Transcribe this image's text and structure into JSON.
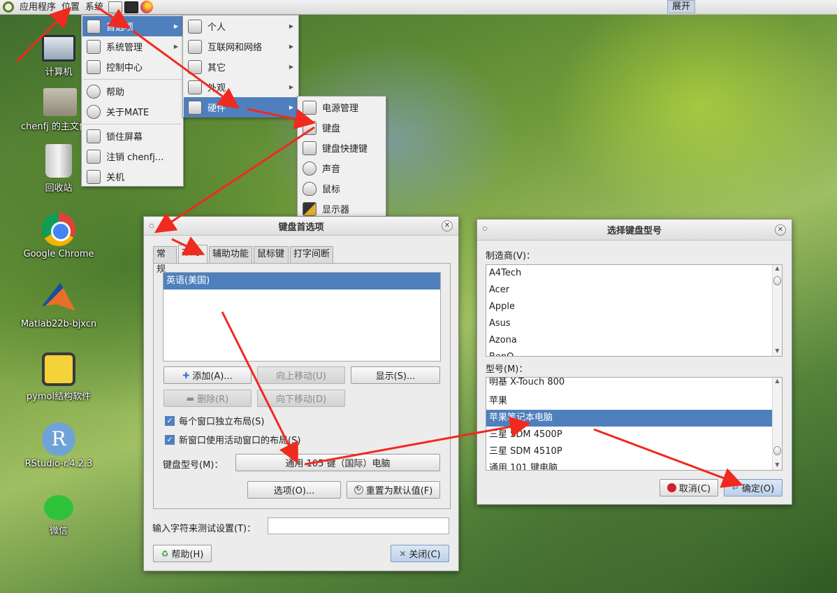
{
  "top_panel": {
    "menus": [
      "应用程序",
      "位置",
      "系统"
    ],
    "expand_label": "展开"
  },
  "desktop_icons": [
    {
      "label": "计算机",
      "icon": "computer-icon"
    },
    {
      "label": "chenfj 的主文件夹",
      "icon": "home-folder-icon"
    },
    {
      "label": "回收站",
      "icon": "trash-icon"
    },
    {
      "label": "Google Chrome",
      "icon": "chrome-icon"
    },
    {
      "label": "Matlab22b-bjxcn",
      "icon": "matlab-icon"
    },
    {
      "label": "pymol结构软件",
      "icon": "pymol-icon"
    },
    {
      "label": "RStudio-r.4.2.3",
      "icon": "rstudio-icon"
    },
    {
      "label": "微信",
      "icon": "wechat-icon"
    }
  ],
  "system_menu": {
    "items": [
      {
        "label": "首选项",
        "icon": "preferences-icon"
      },
      {
        "label": "系统管理",
        "icon": "tools-icon"
      },
      {
        "label": "控制中心",
        "icon": "control-center-icon"
      },
      {
        "label": "帮助",
        "icon": "help-icon"
      },
      {
        "label": "关于MATE",
        "icon": "mate-logo-icon"
      },
      {
        "label": "锁住屏幕",
        "icon": "lock-screen-icon"
      },
      {
        "label": "注销 chenfj...",
        "icon": "logout-icon"
      },
      {
        "label": "关机",
        "icon": "shutdown-icon"
      }
    ]
  },
  "preferences_menu": {
    "items": [
      {
        "label": "个人",
        "icon": "personal-icon"
      },
      {
        "label": "互联网和网络",
        "icon": "network-icon"
      },
      {
        "label": "其它",
        "icon": "other-icon"
      },
      {
        "label": "外观",
        "icon": "appearance-icon"
      },
      {
        "label": "硬件",
        "icon": "hardware-icon"
      }
    ]
  },
  "hardware_menu": {
    "items": [
      {
        "label": "电源管理",
        "icon": "power-icon"
      },
      {
        "label": "键盘",
        "icon": "keyboard-icon"
      },
      {
        "label": "键盘快捷键",
        "icon": "keyboard-shortcut-icon"
      },
      {
        "label": "声音",
        "icon": "sound-icon"
      },
      {
        "label": "鼠标",
        "icon": "mouse-icon"
      },
      {
        "label": "显示器",
        "icon": "display-icon"
      }
    ]
  },
  "keyboard_prefs": {
    "title": "键盘首选项",
    "tabs": [
      "常规",
      "布局",
      "辅助功能",
      "鼠标键",
      "打字间断"
    ],
    "layouts": [
      "英语(美国)"
    ],
    "buttons": {
      "add": "添加(A)...",
      "move_up": "向上移动(U)",
      "show": "显示(S)...",
      "remove": "删除(R)",
      "move_down": "向下移动(D)",
      "options": "选项(O)...",
      "reset": "重置为默认值(F)",
      "help": "帮助(H)",
      "close": "关闭(C)"
    },
    "checkboxes": [
      {
        "label": "每个窗口独立布局(S)",
        "checked": true
      },
      {
        "label": "新窗口使用活动窗口的布局(S)",
        "checked": true
      }
    ],
    "model_label": "键盘型号(M)：",
    "model_value": "通用 105 键（国际）电脑",
    "test_label": "输入字符来测试设置(T)：",
    "test_value": ""
  },
  "model_dialog": {
    "title": "选择键盘型号",
    "vendor_label": "制造商(V)：",
    "vendors": [
      "A4Tech",
      "Acer",
      "Apple",
      "Asus",
      "Azona",
      "BenQ"
    ],
    "model_label": "型号(M)：",
    "models": [
      "明基 X-Touch 800",
      "苹果",
      "苹果笔记本电脑",
      "三星 SDM 4500P",
      "三星 SDM 4510P",
      "通用 101 键电脑"
    ],
    "selected_model": "苹果笔记本电脑",
    "cancel": "取消(C)",
    "ok": "确定(O)"
  },
  "colors": {
    "selection": "#4f80bd",
    "annotation_arrow": "#f02a1e"
  }
}
